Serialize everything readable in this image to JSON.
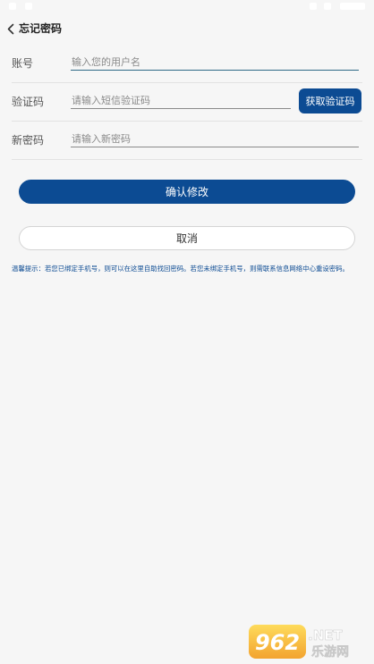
{
  "header": {
    "title": "忘记密码",
    "back_icon": "chevron-left-icon"
  },
  "form": {
    "account": {
      "label": "账号",
      "placeholder": "输入您的用户名"
    },
    "code": {
      "label": "验证码",
      "placeholder": "请输入短信验证码",
      "button": "获取验证码"
    },
    "new_password": {
      "label": "新密码",
      "placeholder": "请输入新密码"
    }
  },
  "actions": {
    "confirm": "确认修改",
    "cancel": "取消"
  },
  "tip": "温馨提示：若您已绑定手机号，则可以在这里自助找回密码。若您未绑定手机号，则需联系信息网络中心重设密码。",
  "watermark": {
    "line1": "962.NET",
    "line2": "乐游网"
  },
  "colors": {
    "primary": "#0c4b93",
    "background": "#f6f6f6",
    "tip": "#0c4b93"
  }
}
